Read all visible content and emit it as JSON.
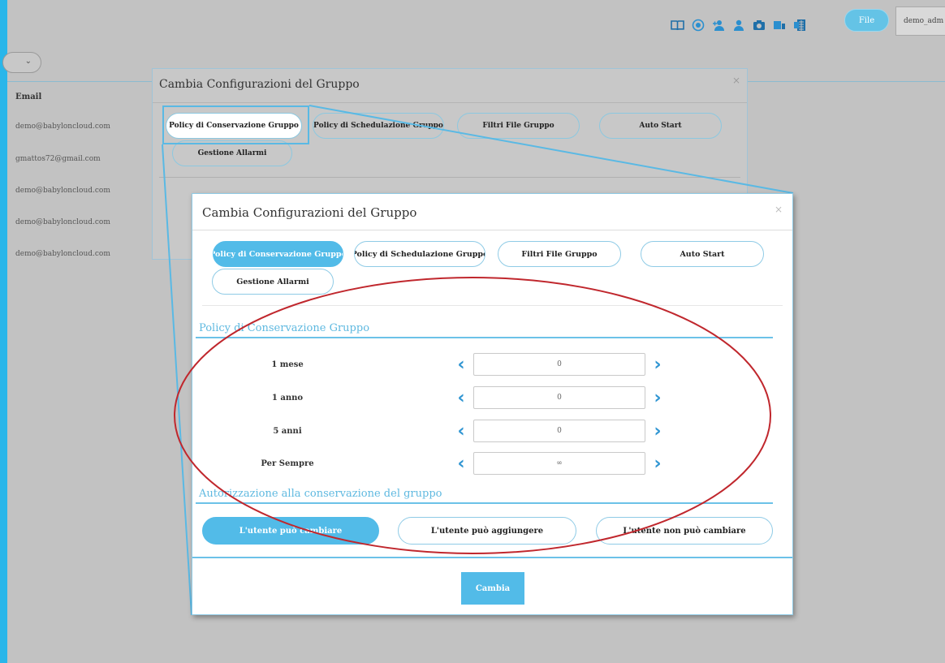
{
  "topbar": {
    "icons": [
      "book-icon",
      "globe-icon",
      "add-user-icon",
      "user-icon",
      "camera-icon",
      "devices-icon",
      "spreadsheet-icon"
    ],
    "file_button": "File",
    "username": "demo_adm"
  },
  "background_list": {
    "header": "Email",
    "emails": [
      "demo@babyloncloud.com",
      "gmattos72@gmail.com",
      "demo@babyloncloud.com",
      "demo@babyloncloud.com",
      "demo@babyloncloud.com"
    ]
  },
  "back_modal": {
    "title": "Cambia Configurazioni del Gruppo",
    "close": "×",
    "tabs": [
      "Policy di Conservazione Gruppo",
      "Policy di Schedulazione Gruppo",
      "Filtri File Gruppo",
      "Auto Start",
      "Gestione Allarmi"
    ]
  },
  "modal": {
    "title": "Cambia Configurazioni del Gruppo",
    "close": "×",
    "tabs": [
      {
        "label": "Policy di Conservazione Gruppo",
        "active": true
      },
      {
        "label": "Policy di Schedulazione Gruppo",
        "active": false
      },
      {
        "label": "Filtri File Gruppo",
        "active": false
      },
      {
        "label": "Auto Start",
        "active": false
      },
      {
        "label": "Gestione Allarmi",
        "active": false
      }
    ],
    "retention_section_title": "Policy di Conservazione Gruppo",
    "retention_rows": [
      {
        "label": "1 mese",
        "value": "0"
      },
      {
        "label": "1 anno",
        "value": "0"
      },
      {
        "label": "5 anni",
        "value": "0"
      },
      {
        "label": "Per Sempre",
        "value": "∞"
      }
    ],
    "permission_section_title": "Autorizzazione alla conservazione del gruppo",
    "permission_options": [
      {
        "label": "L'utente può cambiare",
        "active": true
      },
      {
        "label": "L'utente può aggiungere",
        "active": false
      },
      {
        "label": "L'utente non può cambiare",
        "active": false
      }
    ],
    "submit_label": "Cambia"
  },
  "colors": {
    "accent": "#52bbe8",
    "arrow": "#2f95d2",
    "annotation": "#c0272d",
    "left_strip": "#29b6ea"
  }
}
